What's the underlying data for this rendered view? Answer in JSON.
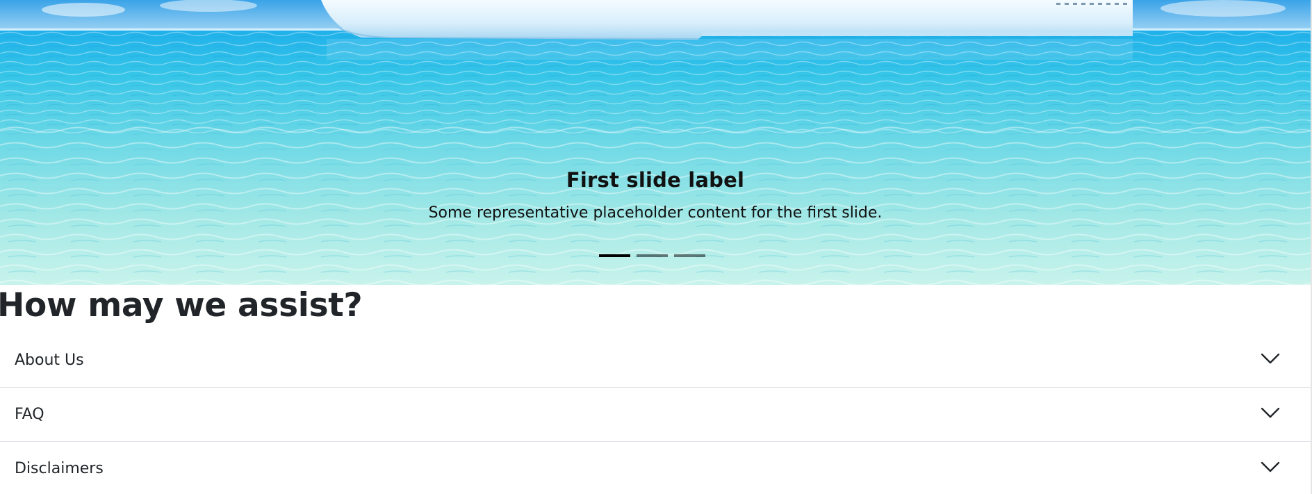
{
  "carousel": {
    "slide_title": "First slide label",
    "slide_text": "Some representative placeholder content for the first slide.",
    "indicator_count": 3,
    "active_indicator": 1
  },
  "assist": {
    "heading": "How may we assist?"
  },
  "accordion": {
    "items": [
      {
        "label": "About Us",
        "icon": "chevron-down-icon"
      },
      {
        "label": "FAQ",
        "icon": "chevron-down-icon"
      },
      {
        "label": "Disclaimers",
        "icon": "chevron-down-icon"
      }
    ]
  },
  "colors": {
    "text": "#212529",
    "divider": "#dee2e6",
    "water_light": "#bff0ec",
    "water_deep": "#27b8e6",
    "hull": "#e9f6fd"
  }
}
